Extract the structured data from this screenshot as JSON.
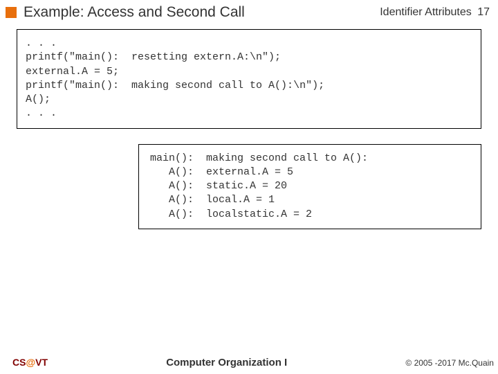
{
  "header": {
    "title": "Example:  Access and Second Call",
    "subject": "Identifier Attributes",
    "page": "17"
  },
  "code": ". . .\nprintf(\"main():  resetting extern.A:\\n\");\nexternal.A = 5;\nprintf(\"main():  making second call to A():\\n\");\nA();\n. . .",
  "output": "main():  making second call to A():\n   A():  external.A = 5\n   A():  static.A = 20\n   A():  local.A = 1\n   A():  localstatic.A = 2",
  "footer": {
    "left_prefix": "CS",
    "left_at": "@",
    "left_suffix": "VT",
    "center": "Computer Organization I",
    "right": "© 2005 -2017 Mc.Quain"
  }
}
